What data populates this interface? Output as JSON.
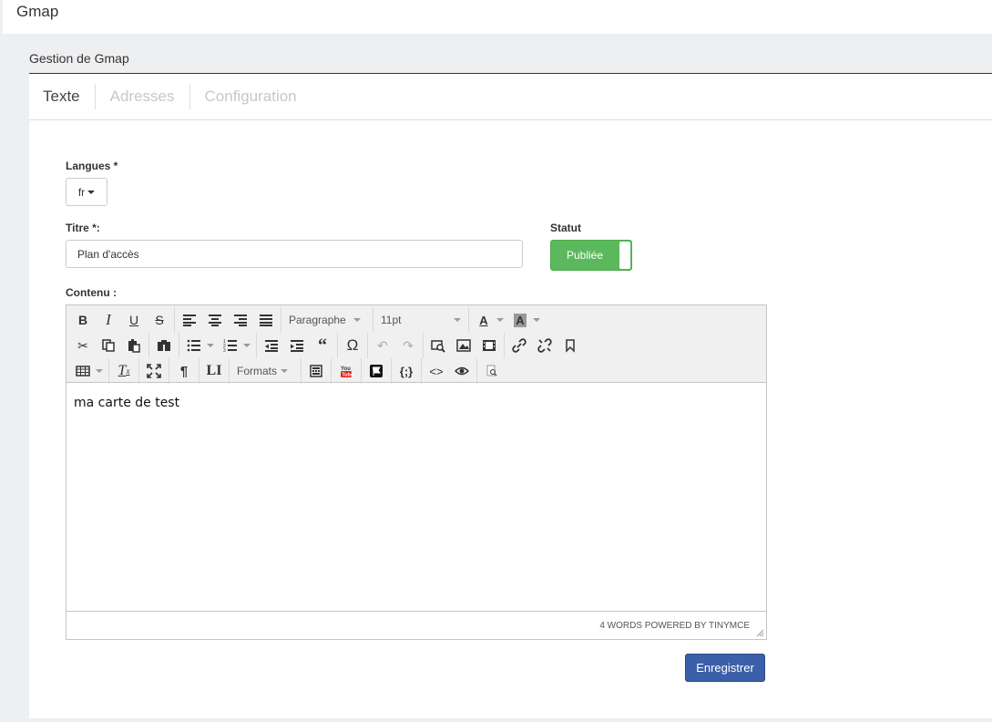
{
  "app": {
    "title": "Gmap"
  },
  "panel": {
    "title": "Gestion de Gmap"
  },
  "tabs": [
    {
      "label": "Texte",
      "active": true
    },
    {
      "label": "Adresses",
      "active": false
    },
    {
      "label": "Configuration",
      "active": false
    }
  ],
  "form": {
    "languages_label": "Langues *",
    "language_value": "fr",
    "title_label": "Titre *:",
    "title_value": "Plan d'accès",
    "status_label": "Statut",
    "status_value": "Publiée",
    "content_label": "Contenu :"
  },
  "editor": {
    "block_format": "Paragraphe",
    "font_size": "11pt",
    "formats_label": "Formats",
    "content": "ma carte de test",
    "statusbar": "4 WORDS POWERED BY TINYMCE",
    "icons_row1": [
      "bold-icon",
      "italic-icon",
      "underline-icon",
      "strikethrough-icon",
      "align-left-icon",
      "align-center-icon",
      "align-right-icon",
      "align-justify-icon",
      "text-color-icon",
      "background-color-icon"
    ],
    "icons_row2": [
      "cut-icon",
      "copy-icon",
      "paste-icon",
      "find-replace-icon",
      "bullet-list-icon",
      "numbered-list-icon",
      "outdent-icon",
      "indent-icon",
      "blockquote-icon",
      "special-char-icon",
      "undo-icon",
      "redo-icon",
      "file-manager-icon",
      "image-icon",
      "media-icon",
      "link-icon",
      "unlink-icon",
      "anchor-icon"
    ],
    "icons_row3": [
      "table-icon",
      "clear-format-icon",
      "fullscreen-icon",
      "visual-chars-icon",
      "ltr-icon",
      "template-icon",
      "youtube-icon",
      "flag-icon",
      "code-sample-icon",
      "source-code-icon",
      "preview-icon",
      "search-icon"
    ]
  },
  "actions": {
    "save_label": "Enregistrer"
  },
  "colors": {
    "accent_save": "#3b5fa8",
    "status_green": "#5cb85c"
  }
}
